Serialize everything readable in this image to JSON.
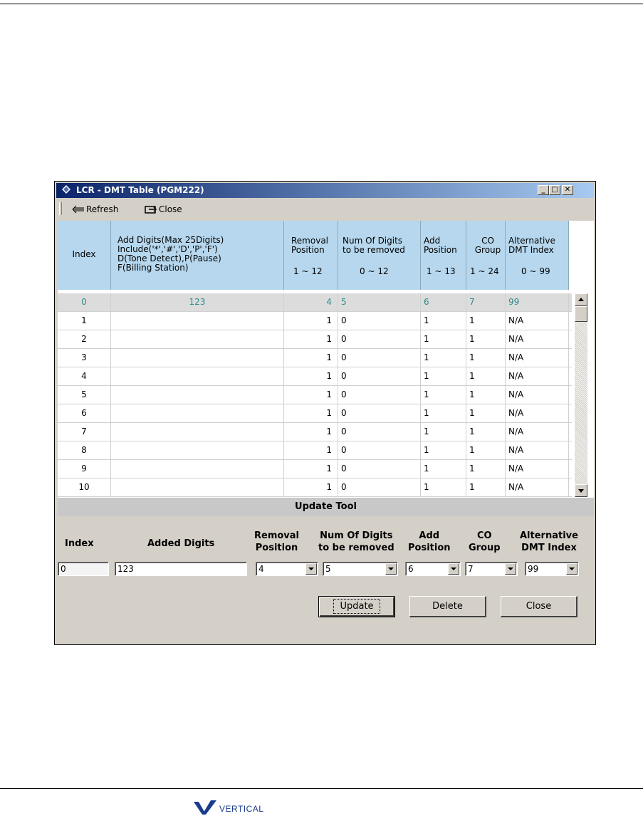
{
  "window": {
    "title": "LCR - DMT Table (PGM222)",
    "minimize_label": "_",
    "maximize_label": "□",
    "close_label": "✕"
  },
  "toolbar": {
    "refresh_label": "Refresh",
    "close_label": "Close"
  },
  "table": {
    "headers": [
      {
        "title": "Index",
        "range": ""
      },
      {
        "title": "Add Digits(Max 25Digits)\nInclude('*','#','D','P','F')\nD(Tone Detect),P(Pause)\nF(Billing Station)",
        "range": ""
      },
      {
        "title": "Removal\nPosition",
        "range": "1 ~ 12"
      },
      {
        "title": "Num Of Digits\nto be removed",
        "range": "0 ~ 12"
      },
      {
        "title": "Add\nPosition",
        "range": "1 ~ 13"
      },
      {
        "title": "CO\nGroup",
        "range": "1 ~ 24"
      },
      {
        "title": "Alternative\nDMT Index",
        "range": "0 ~ 99"
      }
    ],
    "rows": [
      {
        "index": "0",
        "digits": "123",
        "removal": "4",
        "num": "5",
        "add": "6",
        "co": "7",
        "alt": "99"
      },
      {
        "index": "1",
        "digits": "",
        "removal": "1",
        "num": "0",
        "add": "1",
        "co": "1",
        "alt": "N/A"
      },
      {
        "index": "2",
        "digits": "",
        "removal": "1",
        "num": "0",
        "add": "1",
        "co": "1",
        "alt": "N/A"
      },
      {
        "index": "3",
        "digits": "",
        "removal": "1",
        "num": "0",
        "add": "1",
        "co": "1",
        "alt": "N/A"
      },
      {
        "index": "4",
        "digits": "",
        "removal": "1",
        "num": "0",
        "add": "1",
        "co": "1",
        "alt": "N/A"
      },
      {
        "index": "5",
        "digits": "",
        "removal": "1",
        "num": "0",
        "add": "1",
        "co": "1",
        "alt": "N/A"
      },
      {
        "index": "6",
        "digits": "",
        "removal": "1",
        "num": "0",
        "add": "1",
        "co": "1",
        "alt": "N/A"
      },
      {
        "index": "7",
        "digits": "",
        "removal": "1",
        "num": "0",
        "add": "1",
        "co": "1",
        "alt": "N/A"
      },
      {
        "index": "8",
        "digits": "",
        "removal": "1",
        "num": "0",
        "add": "1",
        "co": "1",
        "alt": "N/A"
      },
      {
        "index": "9",
        "digits": "",
        "removal": "1",
        "num": "0",
        "add": "1",
        "co": "1",
        "alt": "N/A"
      },
      {
        "index": "10",
        "digits": "",
        "removal": "1",
        "num": "0",
        "add": "1",
        "co": "1",
        "alt": "N/A"
      }
    ]
  },
  "update_tool": {
    "header": "Update Tool",
    "labels": {
      "index": "Index",
      "added_digits": "Added Digits",
      "removal": "Removal\nPosition",
      "num": "Num Of Digits\nto be removed",
      "add": "Add\nPosition",
      "co": "CO\nGroup",
      "alt": "Alternative\nDMT Index"
    },
    "values": {
      "index": "0",
      "added_digits": "123",
      "removal": "4",
      "num": "5",
      "add": "6",
      "co": "7",
      "alt": "99"
    },
    "buttons": {
      "update": "Update",
      "delete": "Delete",
      "close": "Close"
    }
  },
  "footer": {
    "logo_text": "VERTICAL"
  },
  "colors": {
    "header_bg": "#b6d7ed",
    "selected_text": "#2f8a8a",
    "title_gradient_start": "#0a246a",
    "logo_blue": "#1a3c8c"
  }
}
